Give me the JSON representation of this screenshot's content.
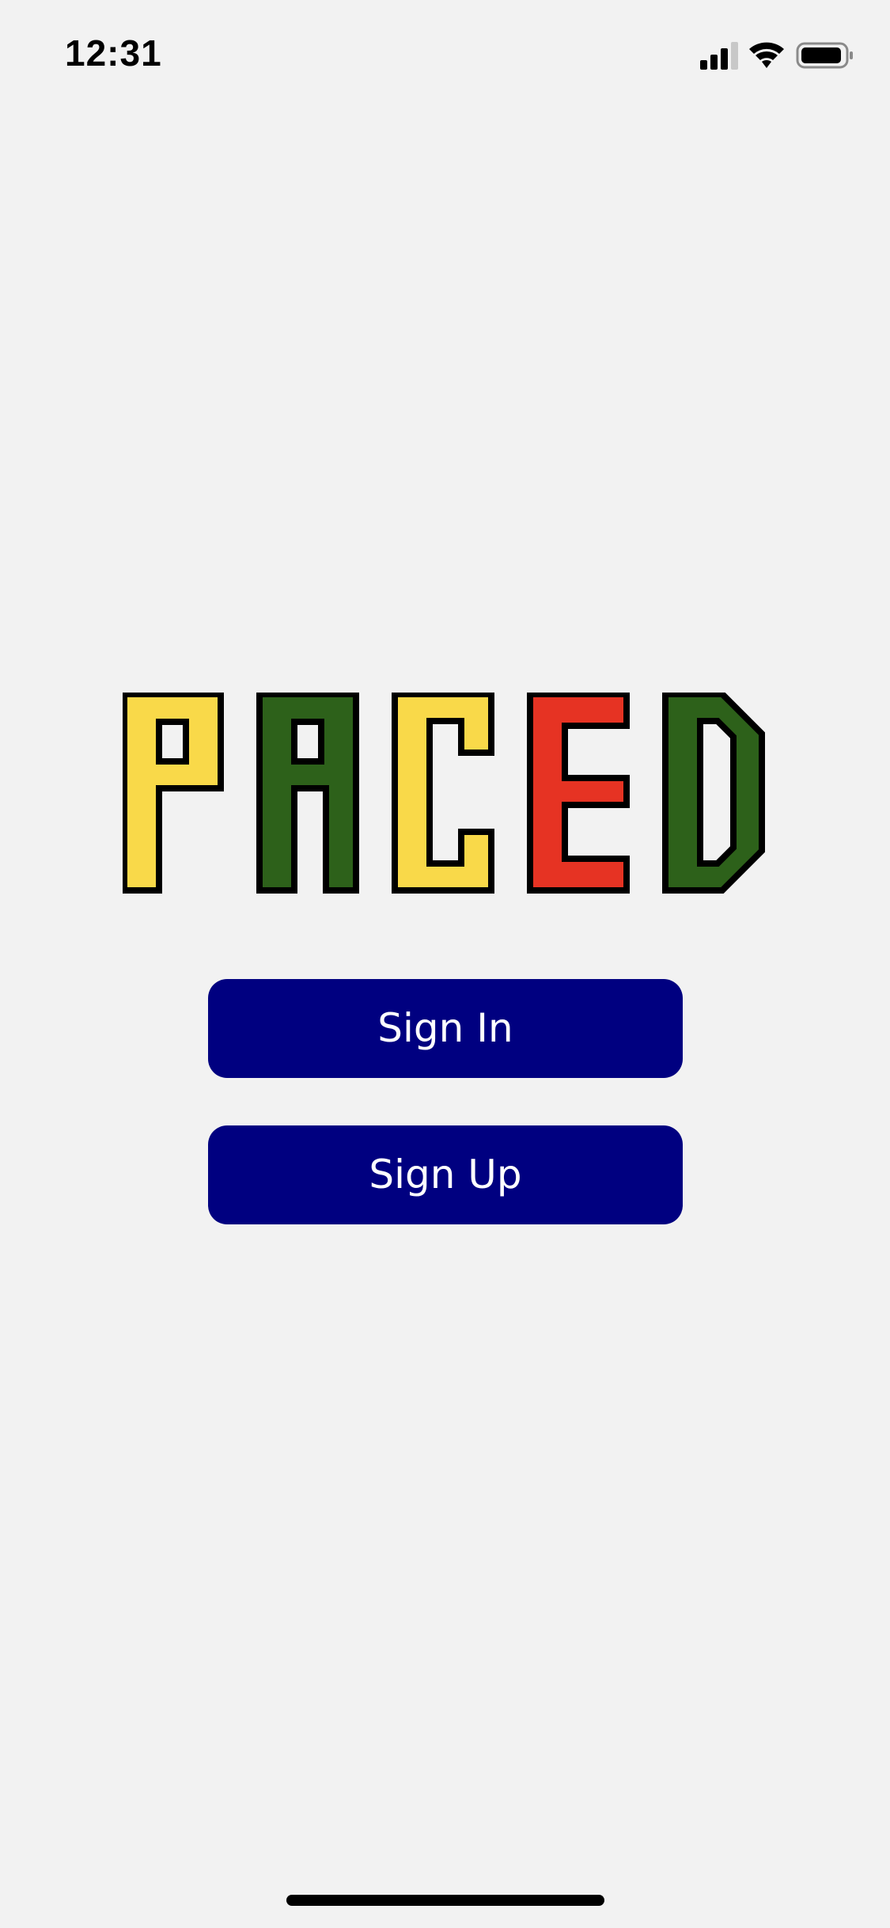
{
  "status_bar": {
    "time": "12:31",
    "icons": [
      "cellular-signal-icon",
      "wifi-icon",
      "battery-icon"
    ]
  },
  "logo": {
    "text": "PACED",
    "letter_colors": [
      "#f9d949",
      "#2d611a",
      "#f9d949",
      "#e63323",
      "#2d611a"
    ],
    "outline_color": "#000000"
  },
  "buttons": {
    "sign_in": "Sign In",
    "sign_up": "Sign Up"
  },
  "colors": {
    "background": "#f2f2f2",
    "button": "#000080",
    "button_text": "#ffffff"
  }
}
